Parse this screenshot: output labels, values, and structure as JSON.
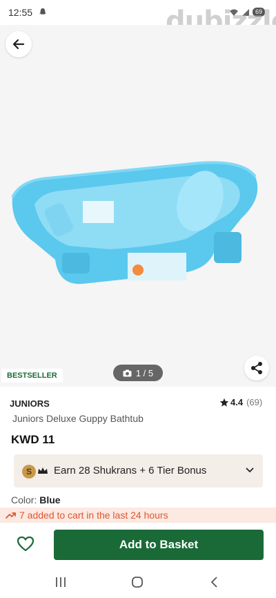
{
  "status_bar": {
    "time": "12:55",
    "battery": "69",
    "watermark": "dubizzle"
  },
  "gallery": {
    "badge": "BESTSELLER",
    "counter": "1 / 5"
  },
  "product": {
    "brand": "JUNIORS",
    "rating": "4.4",
    "rating_count": "(69)",
    "title": "Juniors Deluxe Guppy Bathtub",
    "price": "KWD 11",
    "shukran_coin": "S",
    "shukran_text": "Earn 28 Shukrans + 6 Tier Bonus",
    "color_label": "Color:",
    "color_value": "Blue",
    "cart_notice": "7 added to cart in the last 24 hours"
  },
  "actions": {
    "add_to_basket": "Add to Basket"
  },
  "colors": {
    "brand_green": "#1a6a38",
    "notice_orange": "#e1552d",
    "tub_blue": "#5bc8ee"
  }
}
